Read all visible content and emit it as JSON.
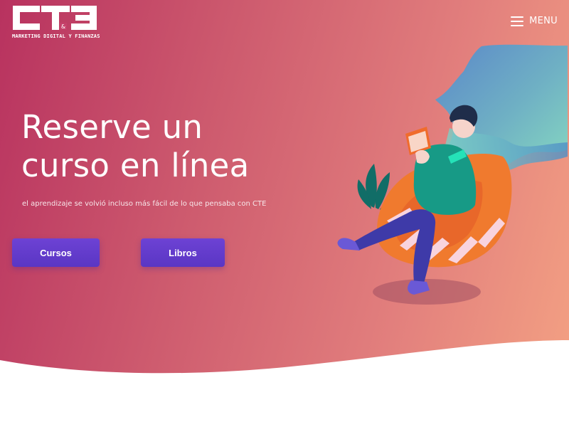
{
  "brand": {
    "logo_letters": "CTE",
    "logo_small": "&",
    "tagline": "MARKETING DIGITAL Y FINANZAS"
  },
  "nav": {
    "menu_label": "MENU",
    "menu_icon": "hamburger-icon"
  },
  "hero": {
    "title_line1": "Reserve un",
    "title_line2": "curso en línea",
    "subtitle": "el aprendizaje se volvió incluso más fácil de lo que pensaba con CTE",
    "illustration": "person-reading-in-chair-illustration"
  },
  "buttons": {
    "cursos": "Cursos",
    "libros": "Libros"
  },
  "colors": {
    "gradient_start": "#b8325f",
    "gradient_end": "#f4a283",
    "button": "#5f3ac8",
    "chair": "#f07a2e",
    "sweater": "#179a86",
    "pants": "#3e3aa8"
  }
}
